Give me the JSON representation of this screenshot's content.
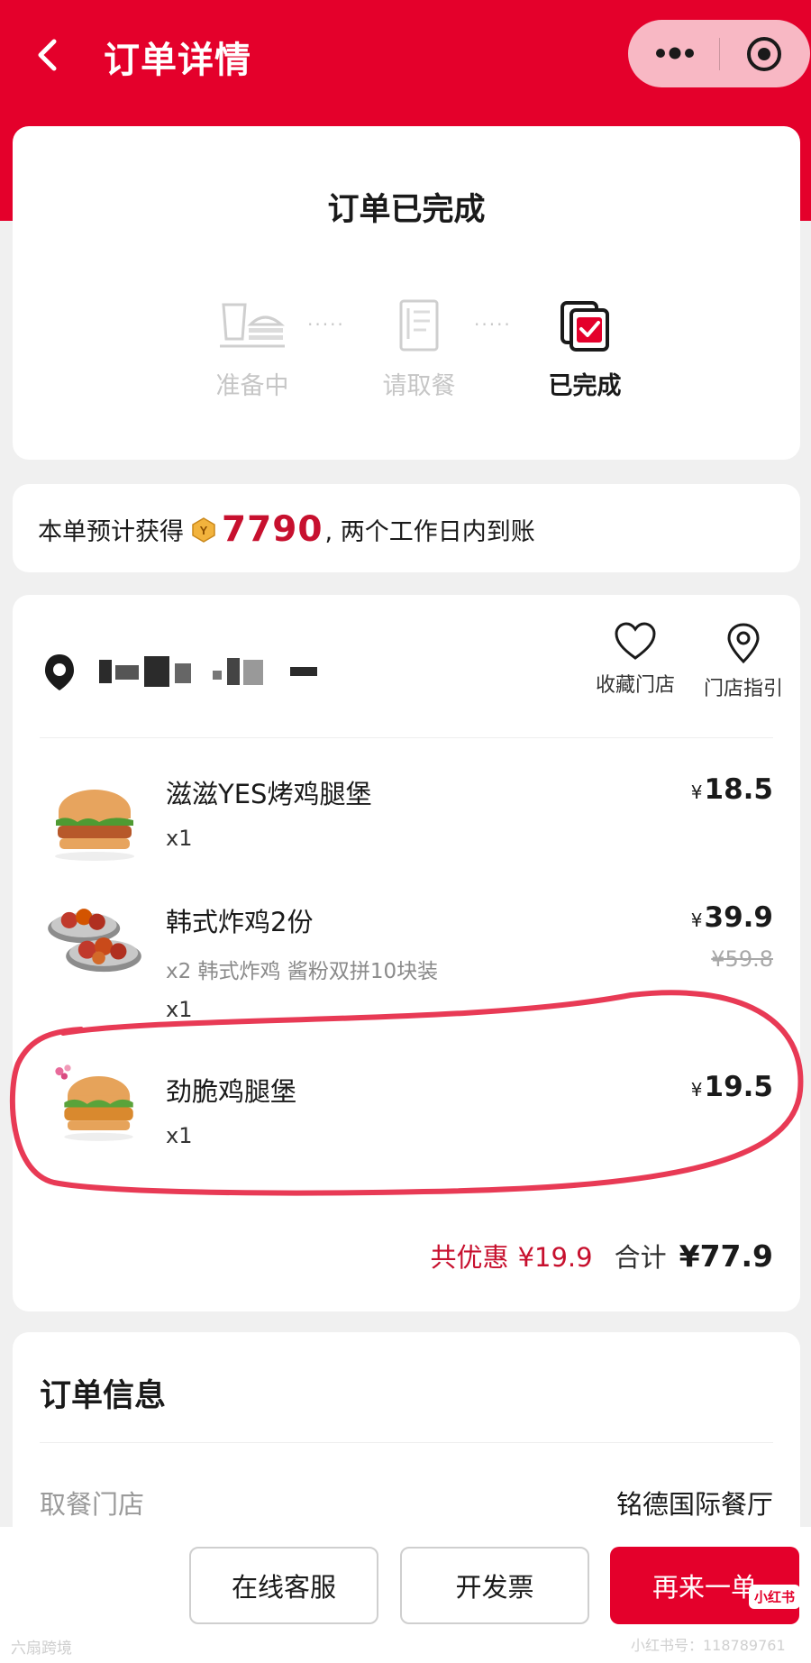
{
  "header": {
    "title": "订单详情"
  },
  "status": {
    "title": "订单已完成",
    "steps": [
      {
        "label": "准备中",
        "state": "done"
      },
      {
        "label": "请取餐",
        "state": "done"
      },
      {
        "label": "已完成",
        "state": "current"
      }
    ]
  },
  "points": {
    "prefix": "本单预计获得",
    "amount": "7790",
    "suffix": ", 两个工作日内到账"
  },
  "store": {
    "actions": {
      "favorite": "收藏门店",
      "directions": "门店指引"
    }
  },
  "items": [
    {
      "name": "滋滋YES烤鸡腿堡",
      "qty": "x1",
      "price": "18.5"
    },
    {
      "name": "韩式炸鸡2份",
      "desc": "x2 韩式炸鸡 酱粉双拼10块装",
      "qty": "x1",
      "price": "39.9",
      "original_price": "¥59.8"
    },
    {
      "name": "劲脆鸡腿堡",
      "qty": "x1",
      "price": "19.5"
    }
  ],
  "currency_symbol": "¥",
  "totals": {
    "discount_label": "共优惠",
    "discount_amount": "¥19.9",
    "total_label": "合计",
    "total_amount": "¥77.9"
  },
  "order_info": {
    "title": "订单信息",
    "rows": [
      {
        "label": "取餐门店",
        "value": "铭德国际餐厅"
      }
    ]
  },
  "bottom_bar": {
    "service": "在线客服",
    "invoice": "开发票",
    "reorder": "再来一单"
  },
  "watermarks": {
    "xhs_badge": "小红书",
    "xhs_id": "小红书号：118789761",
    "left": "六扇跨境"
  },
  "colors": {
    "brand_red": "#e4002b",
    "price_red": "#c7102e",
    "annotation": "#e83a55"
  }
}
